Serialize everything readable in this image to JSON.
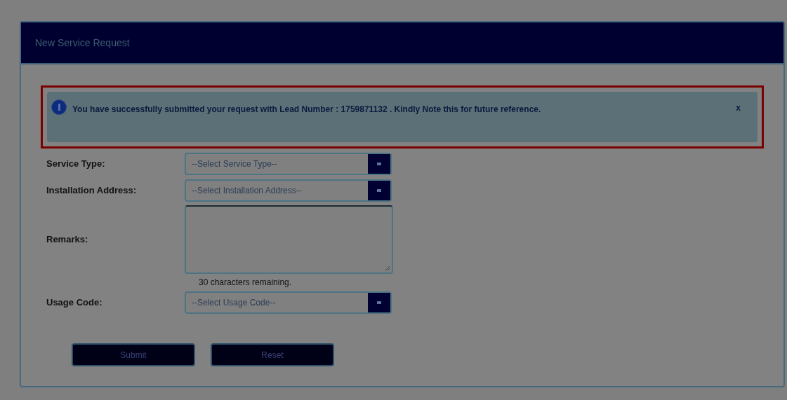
{
  "panel": {
    "title": "New Service Request"
  },
  "alert": {
    "message": "You have successfully submitted your request with Lead Number : 1759871132 . Kindly Note this for future reference.",
    "close": "x"
  },
  "fields": [
    {
      "kind": "select",
      "label": "Service Type:",
      "placeholder": "--Select Service Type--"
    },
    {
      "kind": "select",
      "label": "Installation Address:",
      "placeholder": "--Select Installation Address--"
    },
    {
      "kind": "textarea",
      "label": "Remarks:",
      "hint": "30 characters remaining."
    },
    {
      "kind": "select",
      "label": "Usage Code:",
      "placeholder": "--Select Usage Code--"
    }
  ],
  "buttons": [
    "Submit",
    "Reset"
  ]
}
